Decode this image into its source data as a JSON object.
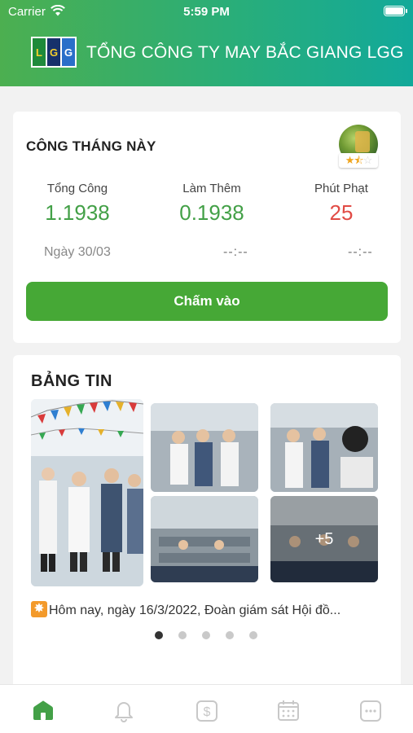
{
  "status_bar": {
    "carrier": "Carrier",
    "time": "5:59 PM"
  },
  "header": {
    "logo_letters": [
      "L",
      "G",
      "G"
    ],
    "company_name": "TỔNG CÔNG TY MAY BẮC GIANG LGG"
  },
  "work_card": {
    "title": "CÔNG THÁNG NÀY",
    "rating_stars": {
      "filled": 1.5,
      "total": 3
    },
    "stats": [
      {
        "label": "Tổng Công",
        "value": "1.1938"
      },
      {
        "label": "Làm Thêm",
        "value": "0.1938"
      },
      {
        "label": "Phút Phạt",
        "value": "25"
      }
    ],
    "date_label": "Ngày 30/03",
    "time_in": "--:--",
    "time_out": "--:--",
    "checkin_label": "Chấm vào"
  },
  "news_card": {
    "title": "BẢNG TIN",
    "more_photos": "+5",
    "caption": "Hôm nay, ngày 16/3/2022, Đoàn giám sát Hội đồ...",
    "carousel": {
      "total": 5,
      "active": 0
    }
  },
  "tabs": [
    {
      "name": "home",
      "icon": "home-icon",
      "active": true
    },
    {
      "name": "notifications",
      "icon": "bell-icon",
      "active": false
    },
    {
      "name": "salary",
      "icon": "dollar-icon",
      "active": false
    },
    {
      "name": "calendar",
      "icon": "calendar-icon",
      "active": false
    },
    {
      "name": "more",
      "icon": "more-icon",
      "active": false
    }
  ],
  "colors": {
    "brand_green": "#46a836",
    "value_green": "#43a047",
    "penalty_red": "#e14b45",
    "tab_active": "#43a047",
    "tab_inactive": "#c8c8c8"
  }
}
